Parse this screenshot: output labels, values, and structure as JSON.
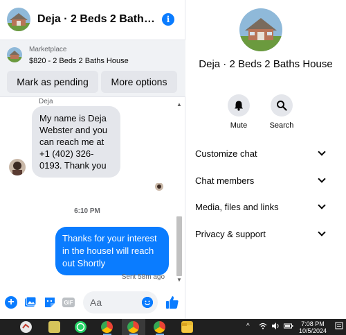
{
  "chat_header": {
    "title": "Deja · 2 Beds 2 Baths House",
    "info_glyph": "i"
  },
  "listing": {
    "label": "Marketplace",
    "price_title": "$820 - 2 Beds 2 Baths House",
    "mark_pending_label": "Mark as pending",
    "more_options_label": "More options"
  },
  "messages": {
    "sender_name": "Deja",
    "incoming_text": "My name is Deja Webster and you can reach me at +1 (402) 326-0193. Thank you",
    "timestamp": "6:10 PM",
    "outgoing_text": "Thanks for your interest in the houseI will reach out Shortly",
    "sent_status": "Sent 58m ago"
  },
  "composer": {
    "placeholder": "Aa",
    "gif_label": "GIF",
    "plus_glyph": "+"
  },
  "details": {
    "name": "Deja · 2 Beds 2 Baths House",
    "actions": [
      {
        "label": "Mute",
        "icon": "bell-icon"
      },
      {
        "label": "Search",
        "icon": "search-icon"
      }
    ],
    "menu": [
      {
        "label": "Customize chat"
      },
      {
        "label": "Chat members"
      },
      {
        "label": "Media, files and links"
      },
      {
        "label": "Privacy & support"
      }
    ]
  },
  "taskbar": {
    "time": "7:08 PM",
    "date": "10/5/2024",
    "tray_chevron": "^"
  },
  "colors": {
    "accent_blue": "#0a7cff",
    "bubble_gray": "#e4e6eb",
    "panel_gray": "#f0f2f5",
    "taskbar": "#202020"
  }
}
